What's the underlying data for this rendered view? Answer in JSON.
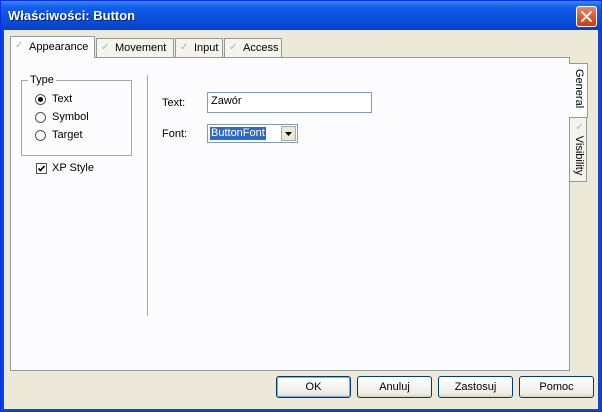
{
  "window": {
    "title": "Właściwości: Button",
    "close_label": "close"
  },
  "tabs": [
    {
      "label": "Appearance",
      "active": true
    },
    {
      "label": "Movement",
      "active": false
    },
    {
      "label": "Input",
      "active": false
    },
    {
      "label": "Access",
      "active": false
    }
  ],
  "side_tabs": [
    {
      "label": "General",
      "active": true
    },
    {
      "label": "Visibility",
      "active": false
    }
  ],
  "type_group": {
    "title": "Type",
    "options": [
      {
        "label": "Text",
        "selected": true
      },
      {
        "label": "Symbol",
        "selected": false
      },
      {
        "label": "Target",
        "selected": false
      }
    ]
  },
  "xp_style": {
    "label": "XP Style",
    "checked": true
  },
  "fields": {
    "text_label": "Text:",
    "text_value": "Zawór",
    "font_label": "Font:",
    "font_value": "ButtonFont"
  },
  "buttons": {
    "ok": "OK",
    "cancel": "Anuluj",
    "apply": "Zastosuj",
    "help": "Pomoc"
  },
  "colors": {
    "title_bar": "#0a53e0",
    "dialog_bg": "#ece9d8",
    "selection": "#316ac5"
  }
}
